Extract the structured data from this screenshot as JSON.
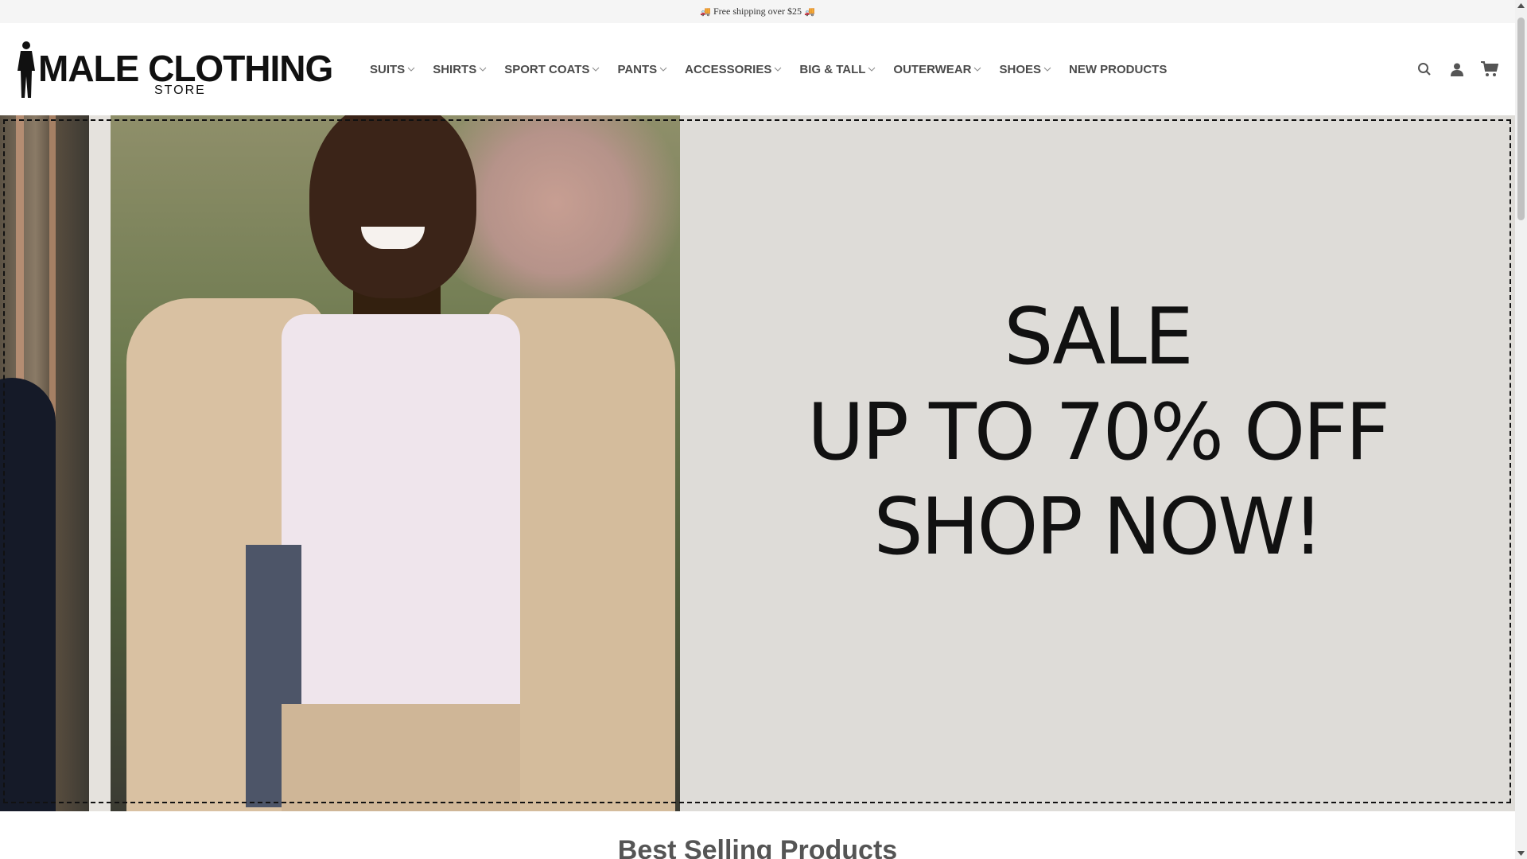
{
  "topbar": {
    "text": "Free shipping over $25",
    "truck_icon": "🚚"
  },
  "logo": {
    "name": "MALE CLOTHING",
    "sub": "STORE"
  },
  "nav": {
    "items": [
      {
        "label": "SUITS",
        "dropdown": true
      },
      {
        "label": "SHIRTS",
        "dropdown": true
      },
      {
        "label": "SPORT COATS",
        "dropdown": true
      },
      {
        "label": "PANTS",
        "dropdown": true
      },
      {
        "label": "ACCESSORIES",
        "dropdown": true
      },
      {
        "label": "BIG & TALL",
        "dropdown": true
      },
      {
        "label": "OUTERWEAR",
        "dropdown": true
      },
      {
        "label": "SHOES",
        "dropdown": true
      },
      {
        "label": "NEW PRODUCTS",
        "dropdown": false
      }
    ]
  },
  "header_icons": [
    "search-icon",
    "user-icon",
    "cart-icon"
  ],
  "hero": {
    "line1": "SALE",
    "line2": "UP TO 70% OFF",
    "line3": "SHOP NOW!"
  },
  "section": {
    "title": "Best Selling Products"
  },
  "colors": {
    "topbar_bg": "#f5f5f5",
    "nav_text": "#4a4a4a",
    "hero_bg": "#dedcd8"
  }
}
